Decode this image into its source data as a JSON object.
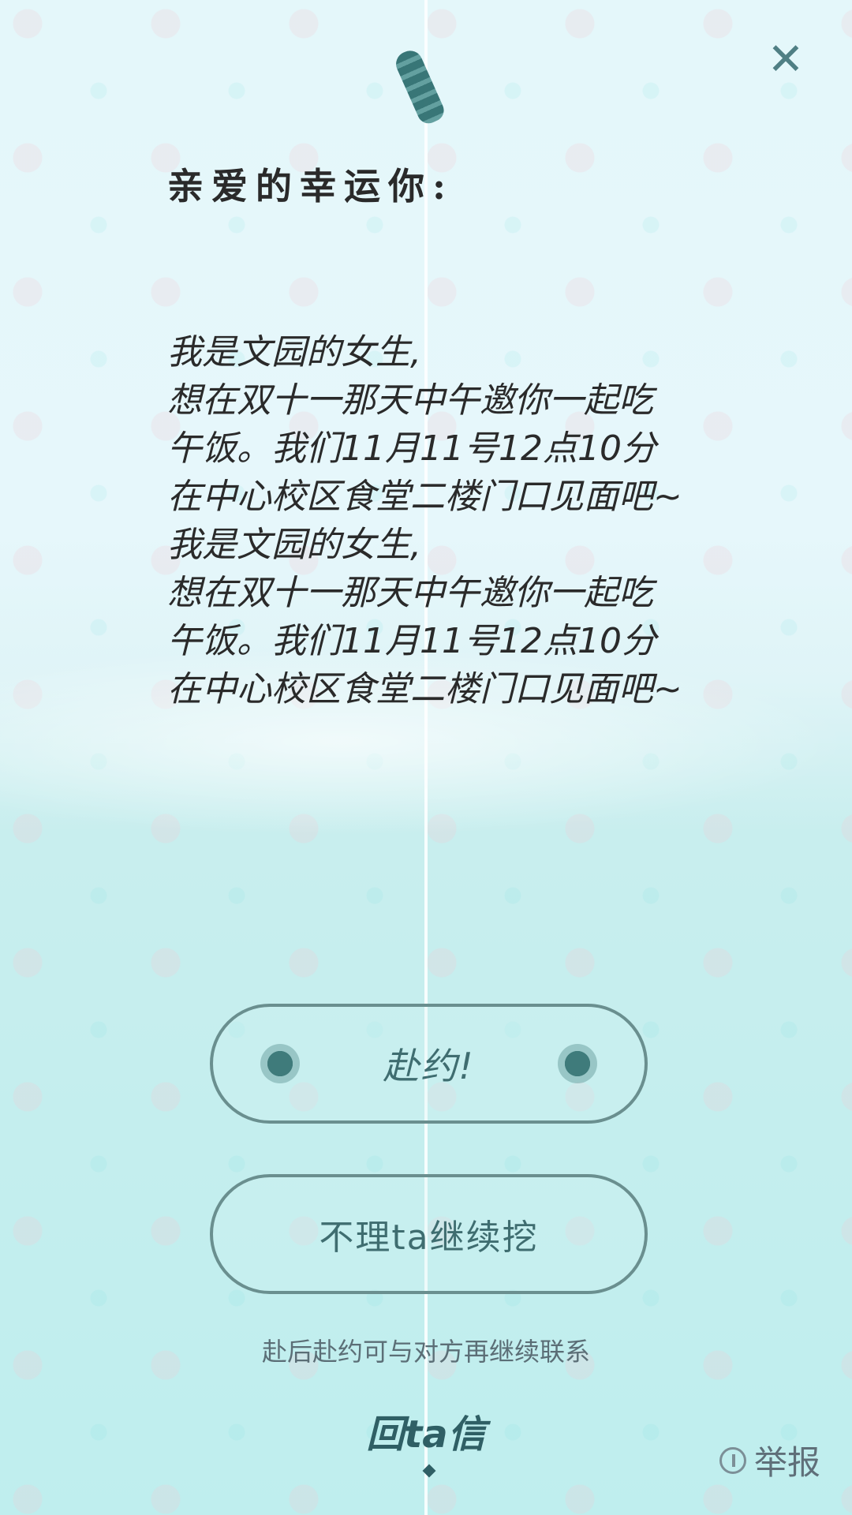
{
  "header": {
    "close_label": "✕"
  },
  "letter": {
    "greeting": "亲爱的幸运你:",
    "body": "我是文园的女生,\n想在双十一那天中午邀你一起吃\n午饭。我们11月11号12点10分\n在中心校区食堂二楼门口见面吧~\n我是文园的女生,\n想在双十一那天中午邀你一起吃\n午饭。我们11月11号12点10分\n在中心校区食堂二楼门口见面吧~"
  },
  "actions": {
    "accept_label": "赴约!",
    "ignore_label": "不理ta继续挖",
    "note": "赴后赴约可与对方再继续联系"
  },
  "footer": {
    "reply_label": "回ta信",
    "report_label": "举报"
  },
  "icons": {
    "bottle": "bottle-icon",
    "close": "close-icon",
    "report": "report-icon"
  },
  "colors": {
    "accent": "#3f6d70",
    "button_border": "#6a8f8f",
    "background_top": "#e4f7fa",
    "background_bottom": "#bfeeee"
  }
}
